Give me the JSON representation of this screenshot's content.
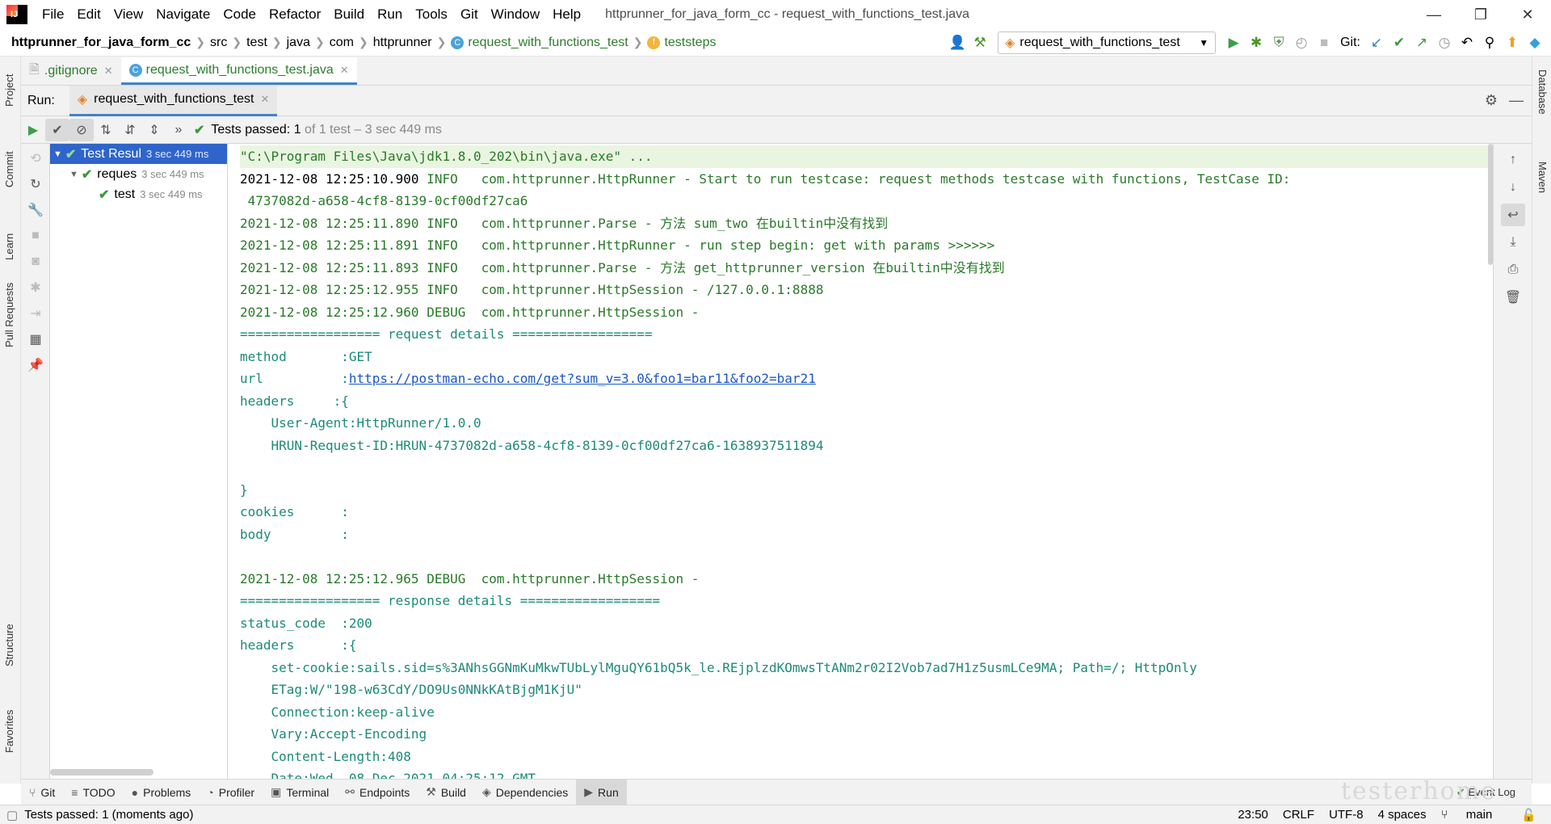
{
  "window": {
    "title": "httprunner_for_java_form_cc - request_with_functions_test.java",
    "menu": [
      "File",
      "Edit",
      "View",
      "Navigate",
      "Code",
      "Refactor",
      "Build",
      "Run",
      "Tools",
      "Git",
      "Window",
      "Help"
    ],
    "controls": {
      "minimize": "—",
      "restore": "❐",
      "close": "✕"
    }
  },
  "nav": {
    "breadcrumbs": [
      "httprunner_for_java_form_cc",
      "src",
      "test",
      "java",
      "com",
      "httprunner",
      "request_with_functions_test",
      "teststeps"
    ],
    "run_config": "request_with_functions_test",
    "git_label": "Git:"
  },
  "left_stripe": [
    "Project",
    "Commit",
    "Learn",
    "Pull Requests",
    "Structure",
    "Favorites"
  ],
  "right_stripe": [
    "Database",
    "Maven"
  ],
  "editor_tabs": [
    {
      "label": ".gitignore",
      "active": false
    },
    {
      "label": "request_with_functions_test.java",
      "active": true
    }
  ],
  "run": {
    "label": "Run:",
    "tab": "request_with_functions_test",
    "status_main": "Tests passed:",
    "status_count": "1",
    "status_rest": "of 1 test – 3 sec 449 ms"
  },
  "tree": [
    {
      "label": "Test Resul",
      "time": "3 sec 449 ms",
      "level": 0,
      "selected": true
    },
    {
      "label": "reques",
      "time": "3 sec 449 ms",
      "level": 1,
      "selected": false
    },
    {
      "label": "test",
      "time": "3 sec 449 ms",
      "level": 2,
      "selected": false
    }
  ],
  "console": {
    "lines": [
      "\"C:\\Program Files\\Java\\jdk1.8.0_202\\bin\\java.exe\" ...",
      "2021-12-08 12:25:10.900 INFO   com.httprunner.HttpRunner - Start to run testcase: request methods testcase with functions, TestCase ID:",
      " 4737082d-a658-4cf8-8139-0cf00df27ca6",
      "2021-12-08 12:25:11.890 INFO   com.httprunner.Parse - 方法 sum_two 在builtin中没有找到",
      "2021-12-08 12:25:11.891 INFO   com.httprunner.HttpRunner - run step begin: get with params >>>>>>",
      "2021-12-08 12:25:11.893 INFO   com.httprunner.Parse - 方法 get_httprunner_version 在builtin中没有找到",
      "2021-12-08 12:25:12.955 INFO   com.httprunner.HttpSession - /127.0.0.1:8888",
      "2021-12-08 12:25:12.960 DEBUG  com.httprunner.HttpSession -",
      "================== request details ==================",
      "method       :GET",
      "url          :",
      "headers     :{",
      "    User-Agent:HttpRunner/1.0.0",
      "    HRUN-Request-ID:HRUN-4737082d-a658-4cf8-8139-0cf00df27ca6-1638937511894",
      "",
      "}",
      "cookies      :",
      "body         :",
      "",
      "2021-12-08 12:25:12.965 DEBUG  com.httprunner.HttpSession -",
      "================== response details ==================",
      "status_code  :200",
      "headers      :{",
      "    set-cookie:sails.sid=s%3ANhsGGNmKuMkwTUbLylMguQY61bQ5k_le.REjplzdKOmwsTtANm2r02I2Vob7ad7H1z5usmLCe9MA; Path=/; HttpOnly",
      "    ETag:W/\"198-w63CdY/DO9Us0NNkKAtBjgM1KjU\"",
      "    Connection:keep-alive",
      "    Vary:Accept-Encoding",
      "    Content-Length:408",
      "    Date:Wed, 08 Dec 2021 04:25:12 GMT"
    ],
    "url_link": "https://postman-echo.com/get?sum_v=3.0&foo1=bar11&foo2=bar21"
  },
  "bottom_tabs": [
    {
      "label": "Git",
      "icon": "⑂"
    },
    {
      "label": "TODO",
      "icon": "≡"
    },
    {
      "label": "Problems",
      "icon": "●"
    },
    {
      "label": "Profiler",
      "icon": "◔"
    },
    {
      "label": "Terminal",
      "icon": "▣"
    },
    {
      "label": "Endpoints",
      "icon": "⚯"
    },
    {
      "label": "Build",
      "icon": "⚒"
    },
    {
      "label": "Dependencies",
      "icon": "◈"
    },
    {
      "label": "Run",
      "icon": "▶"
    }
  ],
  "event_log": "Event Log",
  "status": {
    "message": "Tests passed: 1 (moments ago)",
    "position": "23:50",
    "line_sep": "CRLF",
    "encoding": "UTF-8",
    "indent": "4 spaces",
    "branch": "main"
  },
  "watermark": "testerhome",
  "colors": {
    "accent": "#4083c9",
    "selection": "#2f65ca",
    "console_green": "#2a7a2a",
    "link": "#1a57c4"
  }
}
